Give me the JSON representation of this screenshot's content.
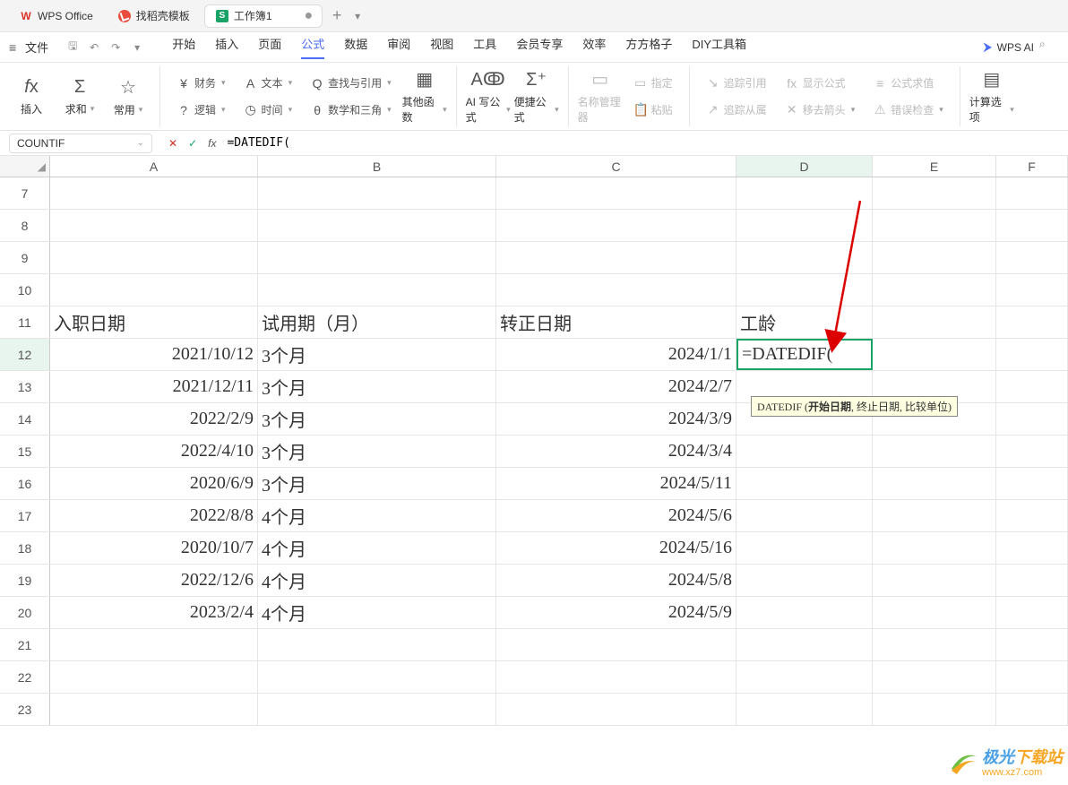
{
  "tabs": {
    "office": "WPS Office",
    "template": "找稻壳模板",
    "workbook": "工作簿1",
    "modified_marker": "●",
    "add": "+"
  },
  "menu": {
    "file": "文件",
    "items": [
      "开始",
      "插入",
      "页面",
      "公式",
      "数据",
      "审阅",
      "视图",
      "工具",
      "会员专享",
      "效率",
      "方方格子",
      "DIY工具箱"
    ],
    "active_index": 3,
    "ai_label": "WPS AI"
  },
  "ribbon": {
    "group1": {
      "insert_fn": "插入",
      "sum": "求和",
      "common": "常用"
    },
    "group2": {
      "finance": "财务",
      "text": "文本",
      "lookup": "查找与引用",
      "logic": "逻辑",
      "time": "时间",
      "math": "数学和三角",
      "other": "其他函数"
    },
    "group3": {
      "ai_formula": "AI 写公式",
      "quick_formula": "便捷公式"
    },
    "group4": {
      "name_manager": "名称管理器",
      "specify": "指定",
      "paste": "粘贴"
    },
    "group5": {
      "trace_ref": "追踪引用",
      "trace_dep": "追踪从属",
      "show_formula": "显示公式",
      "remove_arrow": "移去箭头",
      "eval": "公式求值",
      "error": "错误检查"
    },
    "group6": {
      "calc_options": "计算选项"
    }
  },
  "formula_bar": {
    "name_box": "COUNTIF",
    "formula": "=DATEDIF("
  },
  "grid": {
    "columns": [
      "A",
      "B",
      "C",
      "D",
      "E",
      "F"
    ],
    "active_col": "D",
    "row_numbers": [
      7,
      8,
      9,
      10,
      11,
      12,
      13,
      14,
      15,
      16,
      17,
      18,
      19,
      20,
      21,
      22,
      23
    ],
    "active_row": 12,
    "headers": {
      "A": "入职日期",
      "B": "试用期（月）",
      "C": "转正日期",
      "D": "工龄"
    },
    "rows": [
      {
        "A": "2021/10/12",
        "B": "3个月",
        "C": "2024/1/1",
        "D": "=DATEDIF("
      },
      {
        "A": "2021/12/11",
        "B": "3个月",
        "C": "2024/2/7",
        "D": ""
      },
      {
        "A": "2022/2/9",
        "B": "3个月",
        "C": "2024/3/9",
        "D": ""
      },
      {
        "A": "2022/4/10",
        "B": "3个月",
        "C": "2024/3/4",
        "D": ""
      },
      {
        "A": "2020/6/9",
        "B": "3个月",
        "C": "2024/5/11",
        "D": ""
      },
      {
        "A": "2022/8/8",
        "B": "4个月",
        "C": "2024/5/6",
        "D": ""
      },
      {
        "A": "2020/10/7",
        "B": "4个月",
        "C": "2024/5/16",
        "D": ""
      },
      {
        "A": "2022/12/6",
        "B": "4个月",
        "C": "2024/5/8",
        "D": ""
      },
      {
        "A": "2023/2/4",
        "B": "4个月",
        "C": "2024/5/9",
        "D": ""
      }
    ],
    "tooltip_fn": "DATEDIF",
    "tooltip_arg1": "开始日期",
    "tooltip_rest": ", 终止日期, 比较单位)"
  },
  "watermark": {
    "line1a": "极光",
    "line1b": "下载站",
    "line2": "www.xz7.com"
  }
}
